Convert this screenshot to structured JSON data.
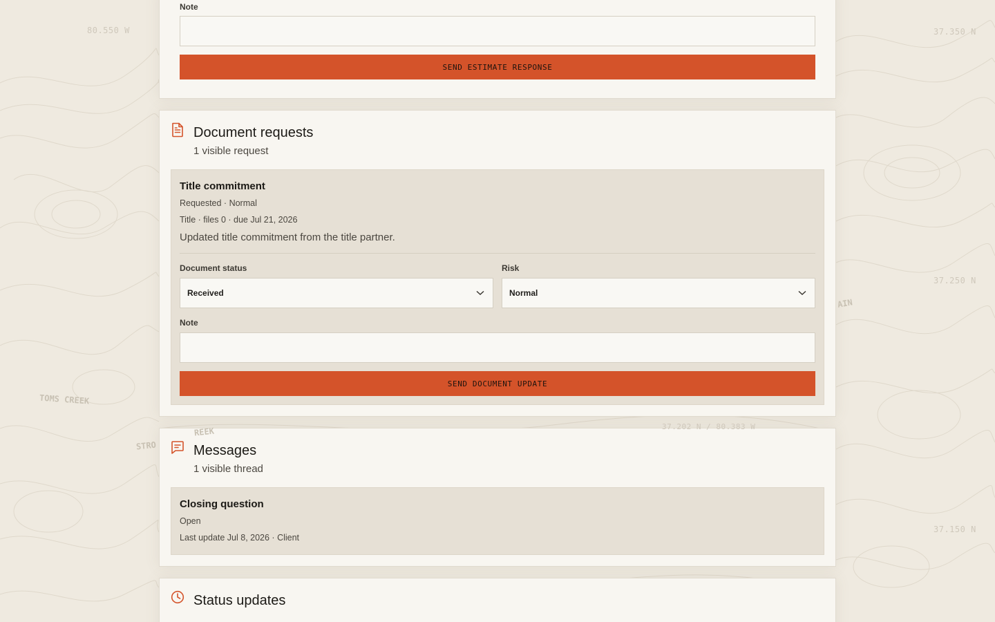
{
  "background": {
    "coords": [
      "80.550 W",
      "37.350 N",
      "37.250 N",
      "37.150 N",
      "37.202 N / 80.383 W"
    ],
    "places": [
      "TOMS CREEK",
      "STRO",
      "REEK",
      "AIN"
    ]
  },
  "estimate_card": {
    "note_label": "Note",
    "note_value": "",
    "button_label": "SEND ESTIMATE RESPONSE"
  },
  "documents": {
    "icon": "document-icon",
    "title": "Document requests",
    "subtitle": "1 visible request",
    "item": {
      "title": "Title commitment",
      "status_line": "Requested · Normal",
      "detail_line": "Title · files 0 · due Jul 21, 2026",
      "description": "Updated title commitment from the title partner.",
      "status_label": "Document status",
      "status_value": "Received",
      "risk_label": "Risk",
      "risk_value": "Normal",
      "note_label": "Note",
      "note_value": "",
      "button_label": "SEND DOCUMENT UPDATE"
    }
  },
  "messages": {
    "icon": "message-icon",
    "title": "Messages",
    "subtitle": "1 visible thread",
    "thread": {
      "title": "Closing question",
      "status": "Open",
      "last_update": "Last update Jul 8, 2026 · Client"
    }
  },
  "status_updates": {
    "icon": "clock-icon",
    "title": "Status updates"
  },
  "colors": {
    "accent": "#d4532a",
    "page_bg": "#efeae0",
    "card_bg": "#f8f6f1",
    "panel_bg": "#e6e0d5"
  }
}
